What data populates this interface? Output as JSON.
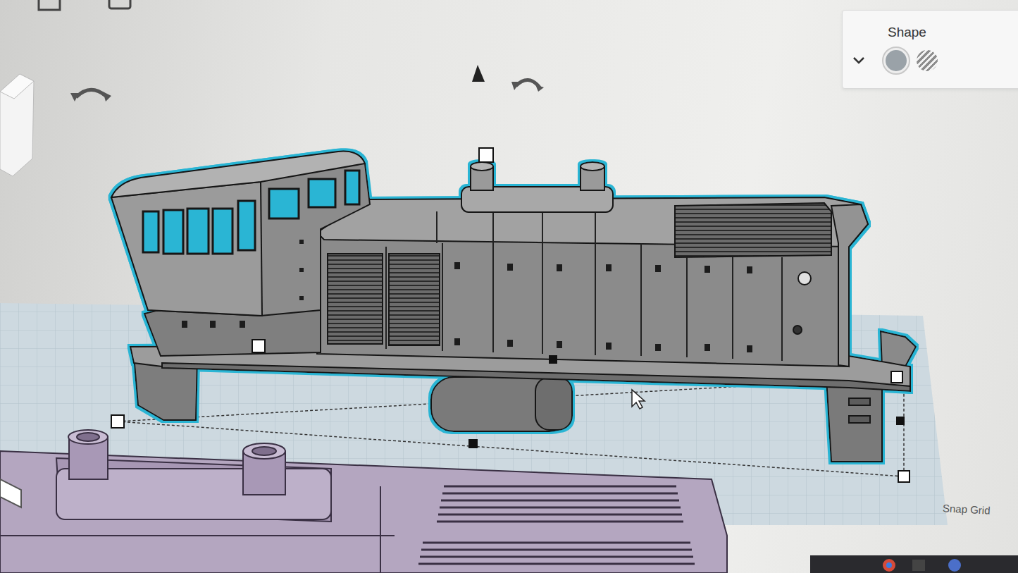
{
  "inspector": {
    "title": "Shape",
    "options": [
      {
        "kind": "solid",
        "selected": true
      },
      {
        "kind": "hole",
        "selected": false
      }
    ]
  },
  "workplane": {
    "snap_grid_label": "Snap Grid"
  }
}
